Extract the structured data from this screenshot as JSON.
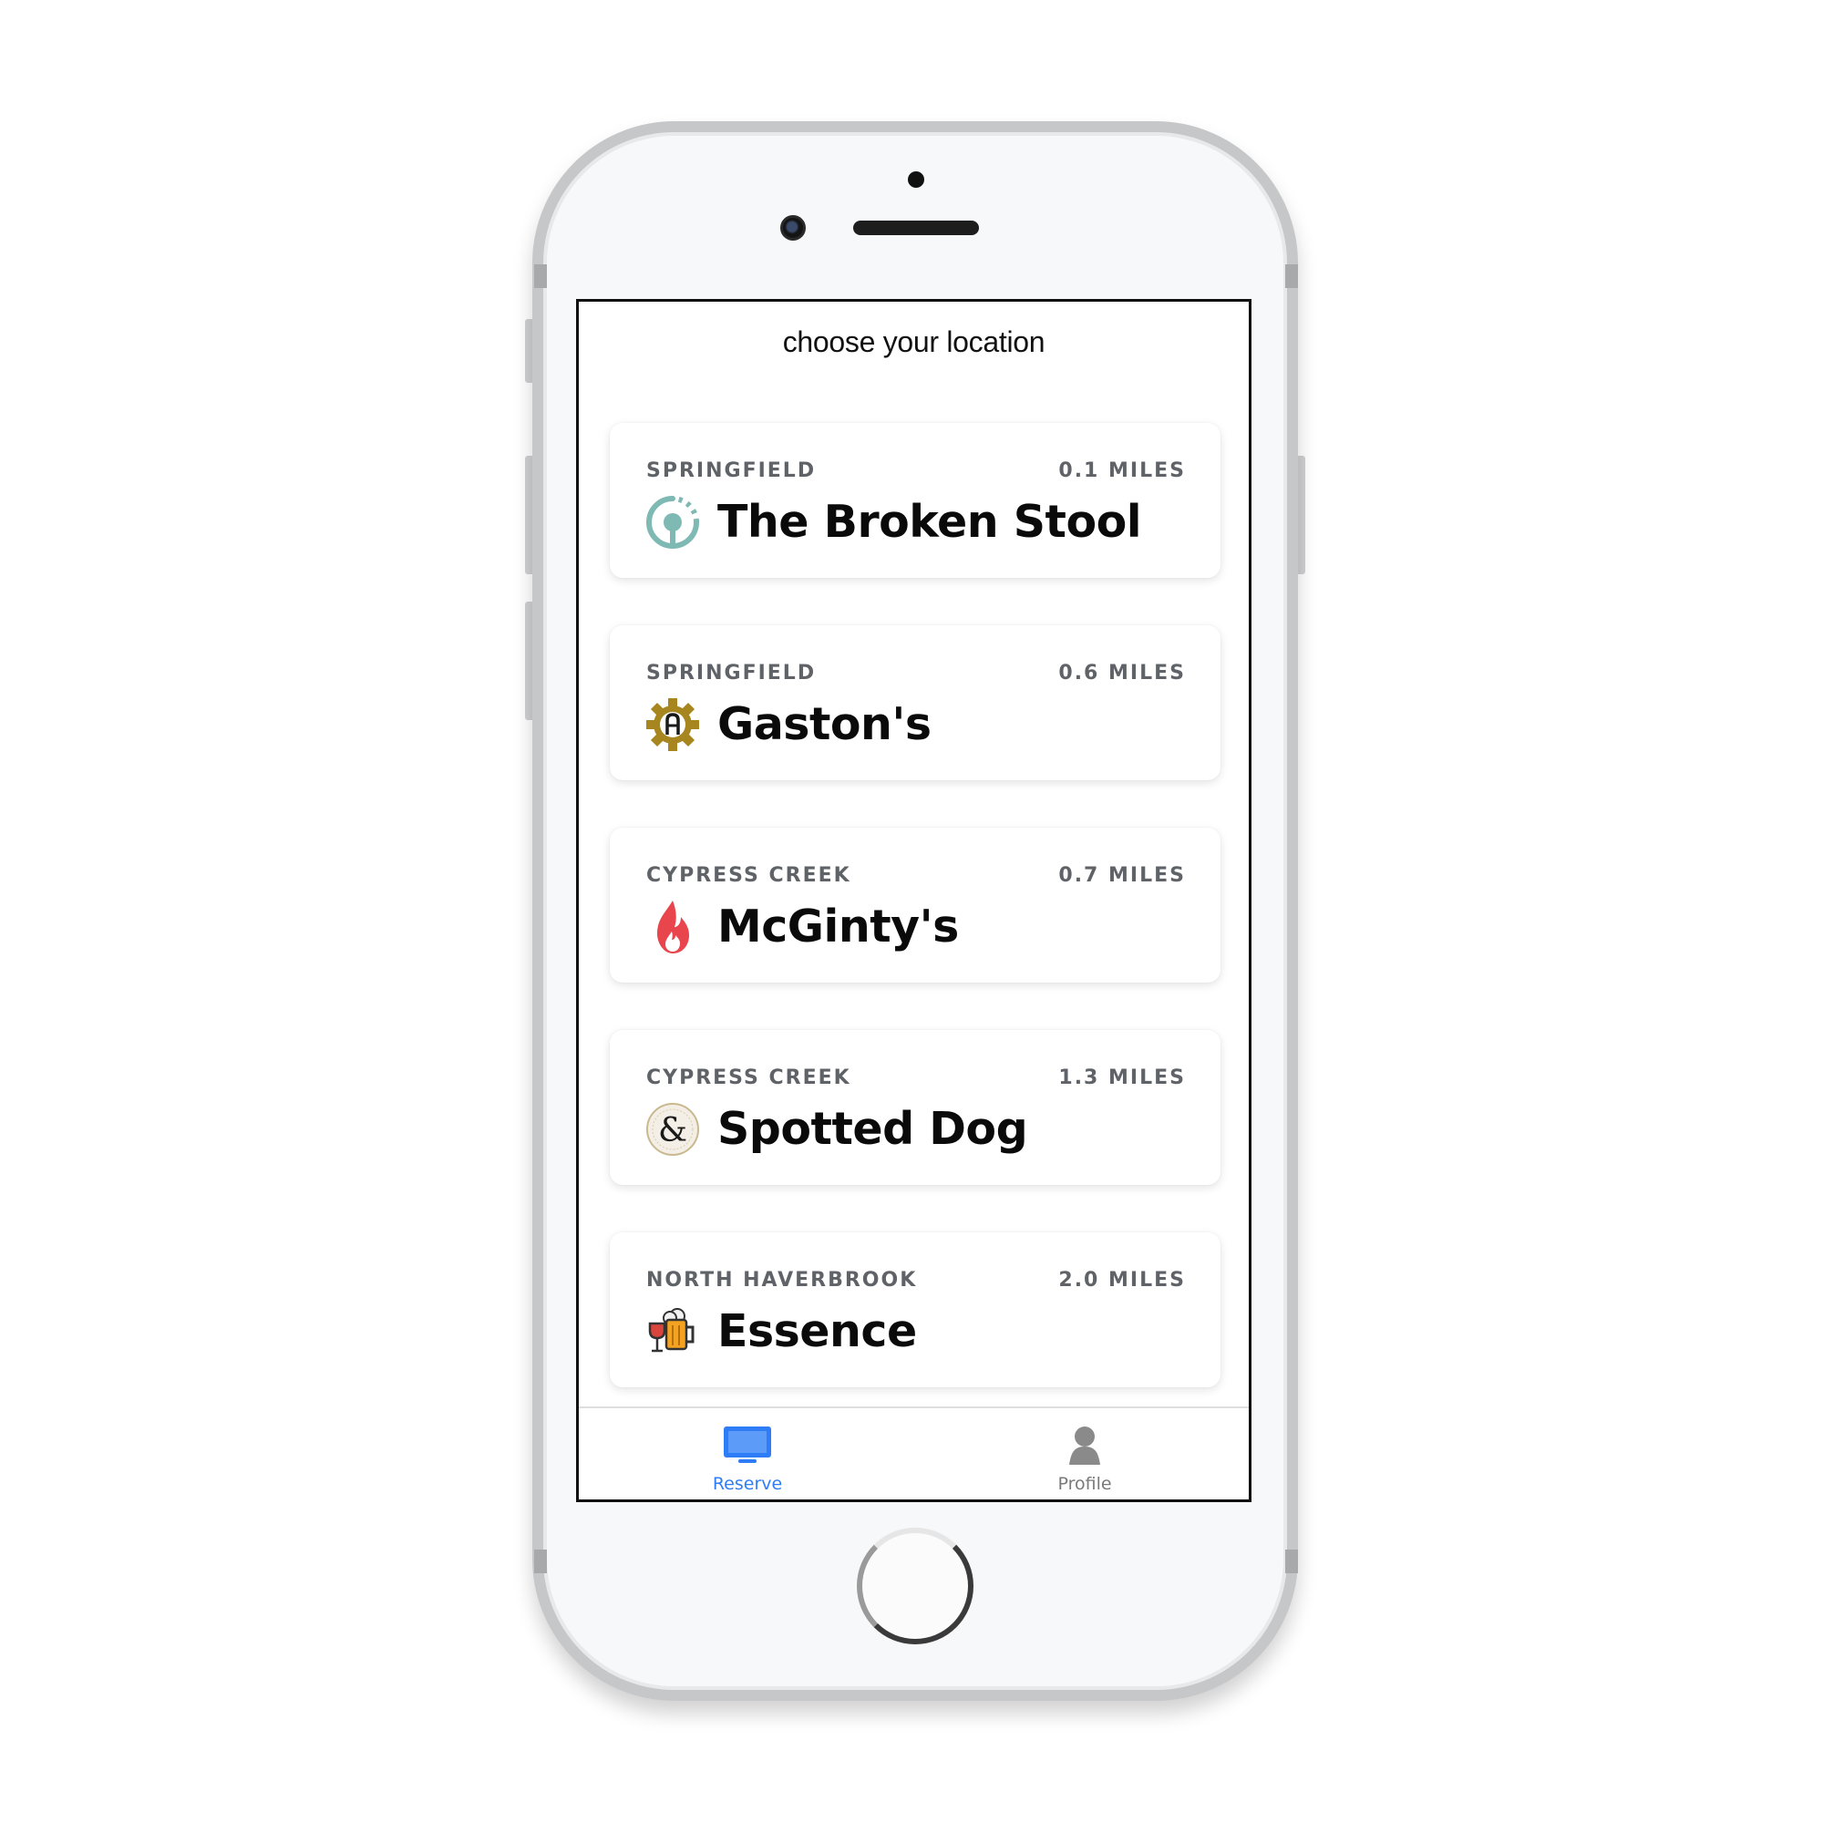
{
  "screen": {
    "title": "choose your location"
  },
  "locations": [
    {
      "area": "SPRINGFIELD",
      "distance": "0.1 MILES",
      "name": "The Broken Stool",
      "icon": "teal-circle-logo-icon"
    },
    {
      "area": "SPRINGFIELD",
      "distance": "0.6 MILES",
      "name": "Gaston's",
      "icon": "gold-gear-a-logo-icon"
    },
    {
      "area": "CYPRESS CREEK",
      "distance": "0.7 MILES",
      "name": "McGinty's",
      "icon": "red-flame-logo-icon"
    },
    {
      "area": "CYPRESS CREEK",
      "distance": "1.3 MILES",
      "name": "Spotted Dog",
      "icon": "ampersand-seal-logo-icon"
    },
    {
      "area": "NORTH HAVERBROOK",
      "distance": "2.0 MILES",
      "name": "Essence",
      "icon": "wine-beer-logo-icon"
    }
  ],
  "tabs": [
    {
      "label": "Reserve",
      "icon": "monitor-icon",
      "active": true
    },
    {
      "label": "Profile",
      "icon": "person-icon",
      "active": false
    }
  ],
  "colors": {
    "accent": "#2f7df6",
    "inactive_tab": "#7a7a7a",
    "subtitle": "#5f6368",
    "teal_logo": "#7fb9b3",
    "gold_logo": "#a8861f",
    "red_logo": "#e8454c"
  }
}
